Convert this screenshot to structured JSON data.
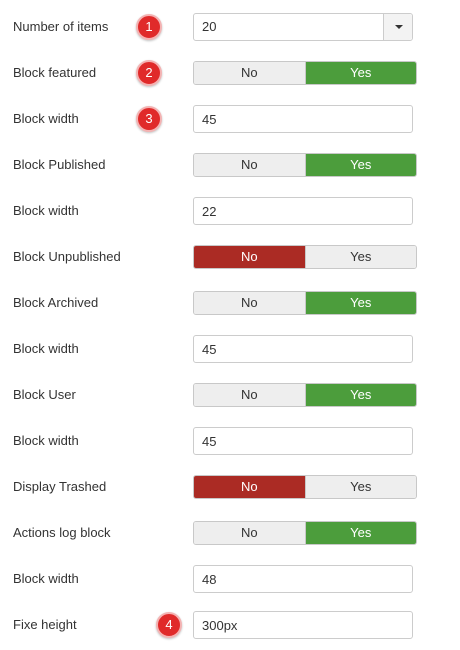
{
  "colors": {
    "yes_active": "#4c9d3c",
    "no_active": "#ab2b24",
    "badge": "#e02a2a"
  },
  "toggle_labels": {
    "no": "No",
    "yes": "Yes"
  },
  "rows": [
    {
      "label": "Number of items",
      "type": "select",
      "value": "20",
      "badge": "1"
    },
    {
      "label": "Block featured",
      "type": "toggle",
      "selected": "Yes",
      "badge": "2"
    },
    {
      "label": "Block width",
      "type": "text",
      "value": "45",
      "badge": "3"
    },
    {
      "label": "Block Published",
      "type": "toggle",
      "selected": "Yes"
    },
    {
      "label": "Block width",
      "type": "text",
      "value": "22"
    },
    {
      "label": "Block Unpublished",
      "type": "toggle",
      "selected": "No"
    },
    {
      "label": "Block Archived",
      "type": "toggle",
      "selected": "Yes"
    },
    {
      "label": "Block width",
      "type": "text",
      "value": "45"
    },
    {
      "label": "Block User",
      "type": "toggle",
      "selected": "Yes"
    },
    {
      "label": "Block width",
      "type": "text",
      "value": "45"
    },
    {
      "label": "Display Trashed",
      "type": "toggle",
      "selected": "No"
    },
    {
      "label": "Actions log block",
      "type": "toggle",
      "selected": "Yes"
    },
    {
      "label": "Block width",
      "type": "text",
      "value": "48"
    },
    {
      "label": "Fixe height",
      "type": "text",
      "value": "300px",
      "badge": "4"
    }
  ]
}
